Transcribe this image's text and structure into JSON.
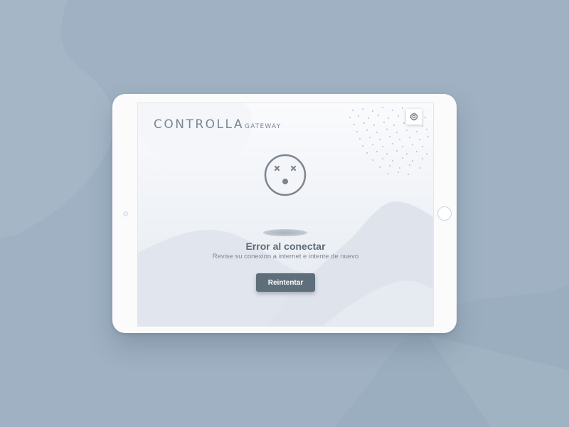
{
  "brand": {
    "name": "CONTROLLA",
    "suffix": "GATEWAY"
  },
  "settings": {
    "icon": "gear-icon"
  },
  "status_icon": "sad-face-icon",
  "error": {
    "title": "Error al conectar",
    "message": "Revise su conexion a internet e intente de nuevo"
  },
  "actions": {
    "retry_label": "Reintentar"
  },
  "colors": {
    "background": "#9fb1c2",
    "device": "#fbfbfc",
    "button": "#5f6e7b",
    "text_primary": "#5d6b78",
    "text_secondary": "#7c8894"
  }
}
